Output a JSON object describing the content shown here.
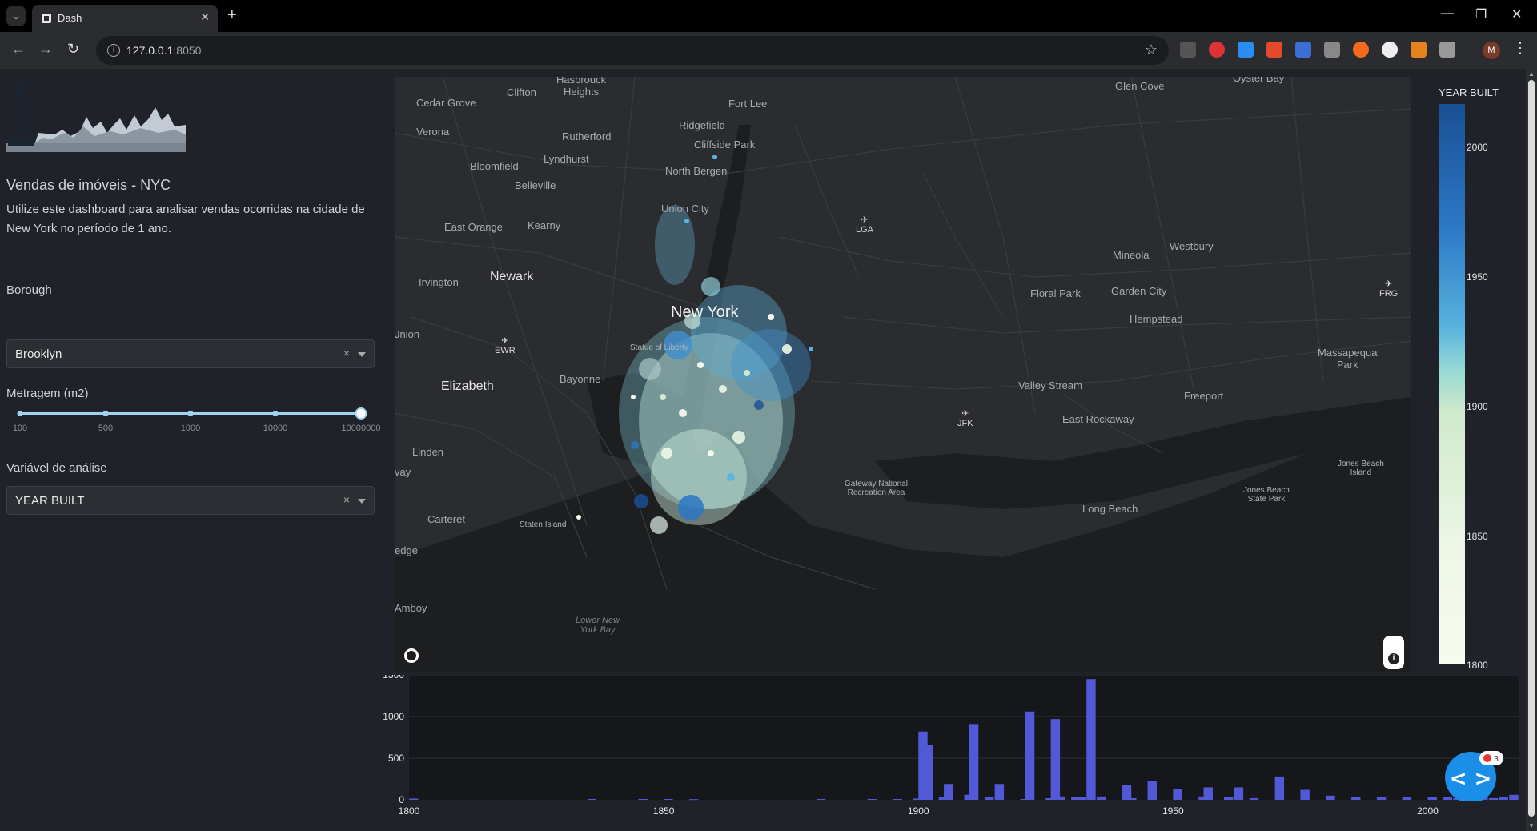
{
  "browser": {
    "tab_title": "Dash",
    "url_host": "127.0.0.1",
    "url_port": ":8050",
    "profile_initial": "M"
  },
  "sidebar": {
    "title": "Vendas de imóveis - NYC",
    "description": "Utilize este dashboard para analisar vendas ocorridas na cidade de New York no período de 1 ano.",
    "borough_label": "Borough",
    "borough_value": "Brooklyn",
    "metragem_label": "Metragem (m2)",
    "slider_marks": [
      "100",
      "500",
      "1000",
      "10000",
      "10000000"
    ],
    "variavel_label": "Variável de análise",
    "variavel_value": "YEAR BUILT",
    "clear_symbol": "×"
  },
  "map": {
    "labels": {
      "hasbrouck": "Hasbrouck\nHeights",
      "clifton": "Clifton",
      "cedar_grove": "Cedar Grove",
      "fort_lee": "Fort Lee",
      "glen_cove": "Glen Cove",
      "oyster_bay": "Oyster Bay",
      "verona": "Verona",
      "rutherford": "Rutherford",
      "ridgefield": "Ridgefield",
      "cliffside": "Cliffside Park",
      "lyndhurst": "Lyndhurst",
      "bloomfield": "Bloomfield",
      "north_bergen": "North Bergen",
      "belleville": "Belleville",
      "union_city": "Union City",
      "east_orange": "East Orange",
      "kearny": "Kearny",
      "mineola": "Mineola",
      "westbury": "Westbury",
      "irvington": "Irvington",
      "newark": "Newark",
      "floral_park": "Floral Park",
      "garden_city": "Garden City",
      "new_york": "New York",
      "hempstead": "Hempstead",
      "union": "Jnion",
      "statue": "Statue of Liberty",
      "massapequa": "Massapequa\nPark",
      "bayonne": "Bayonne",
      "elizabeth": "Elizabeth",
      "valley_stream": "Valley Stream",
      "freeport": "Freeport",
      "east_rockaway": "East Rockaway",
      "linden": "Linden",
      "way": "vay",
      "gateway": "Gateway National\nRecreation Area",
      "jones_beach_island": "Jones Beach\nIsland",
      "jones_beach_park": "Jones Beach\nState Park",
      "carteret": "Carteret",
      "staten_island": "Staten Island",
      "long_beach": "Long Beach",
      "edge": "edge",
      "amboy": "Amboy",
      "lower_ny_bay": "Lower New\nYork Bay"
    },
    "airports": {
      "lga": "LGA",
      "ewr": "EWR",
      "jfk": "JFK",
      "frg": "FRG"
    }
  },
  "colorbar": {
    "title": "YEAR BUILT",
    "ticks": [
      "2000",
      "1950",
      "1900",
      "1850",
      "1800"
    ]
  },
  "chart_data": {
    "type": "bar",
    "title": "",
    "xlabel": "",
    "ylabel": "",
    "xlim": [
      1800,
      2018
    ],
    "ylim": [
      0,
      1500
    ],
    "xticks": [
      1800,
      1850,
      1900,
      1950,
      2000
    ],
    "yticks": [
      0,
      500,
      1000,
      1500
    ],
    "bar_color": "#5159d6",
    "x": [
      1800,
      1835,
      1845,
      1850,
      1855,
      1880,
      1890,
      1895,
      1899,
      1900,
      1901,
      1904,
      1905,
      1909,
      1910,
      1913,
      1915,
      1920,
      1921,
      1925,
      1926,
      1927,
      1930,
      1931,
      1933,
      1935,
      1940,
      1941,
      1945,
      1950,
      1955,
      1956,
      1960,
      1962,
      1965,
      1970,
      1975,
      1980,
      1985,
      1990,
      1995,
      2000,
      2003,
      2005,
      2007,
      2009,
      2010,
      2012,
      2014,
      2016
    ],
    "values": [
      15,
      10,
      10,
      10,
      8,
      10,
      10,
      10,
      15,
      820,
      660,
      30,
      190,
      60,
      910,
      30,
      190,
      10,
      1060,
      20,
      970,
      40,
      30,
      30,
      1450,
      40,
      180,
      20,
      230,
      130,
      40,
      150,
      30,
      150,
      20,
      280,
      120,
      50,
      30,
      30,
      30,
      30,
      30,
      20,
      20,
      30,
      80,
      20,
      30,
      60
    ]
  },
  "widget": {
    "badge": "3"
  }
}
